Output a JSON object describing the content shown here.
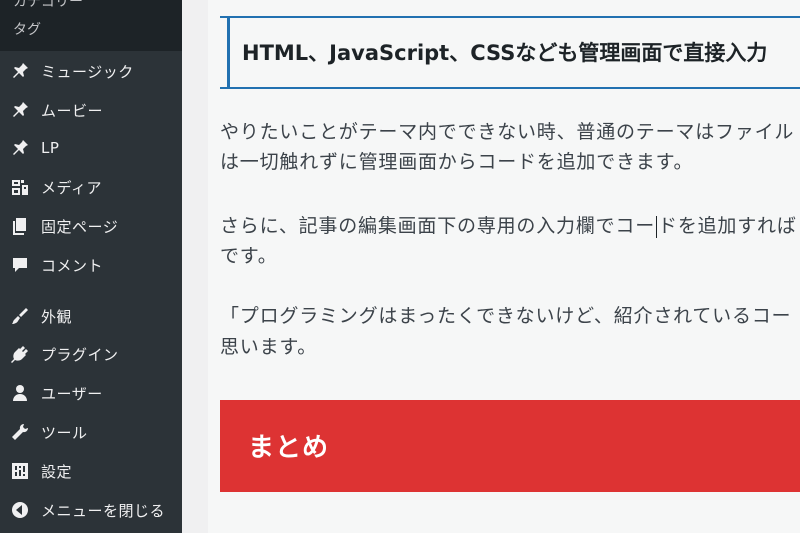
{
  "sidebar": {
    "submenu": [
      {
        "label": "カテゴリー"
      },
      {
        "label": "タグ"
      }
    ],
    "items": [
      {
        "label": "ミュージック",
        "icon": "pin-icon"
      },
      {
        "label": "ムービー",
        "icon": "pin-icon"
      },
      {
        "label": "LP",
        "icon": "pin-icon"
      },
      {
        "label": "メディア",
        "icon": "media-icon"
      },
      {
        "label": "固定ページ",
        "icon": "page-icon"
      },
      {
        "label": "コメント",
        "icon": "comment-icon"
      },
      {
        "label": "外観",
        "icon": "brush-icon"
      },
      {
        "label": "プラグイン",
        "icon": "plugin-icon"
      },
      {
        "label": "ユーザー",
        "icon": "user-icon"
      },
      {
        "label": "ツール",
        "icon": "wrench-icon"
      },
      {
        "label": "設定",
        "icon": "settings-icon"
      },
      {
        "label": "メニューを閉じる",
        "icon": "collapse-icon"
      }
    ]
  },
  "editor": {
    "heading": "HTML、JavaScript、CSSなども管理画面で直接入力",
    "para1_line1": "やりたいことがテーマ内でできない時、普通のテーマはファイル",
    "para1_line2": "は一切触れずに管理画面からコードを追加できます。",
    "para2_line1_before": "さらに、記事の編集画面下の専用の入力欄でコー",
    "para2_line1_after": "ドを追加すれば",
    "para2_line2": "です。",
    "para3_line1": "「プログラミングはまったくできないけど、紹介されているコー",
    "para3_line2": "思います。",
    "summary_heading": "まとめ"
  },
  "colors": {
    "sidebar_bg": "#2c3338",
    "submenu_bg": "#1d2327",
    "accent_blue": "#2271b1",
    "summary_red": "#dd3333"
  }
}
